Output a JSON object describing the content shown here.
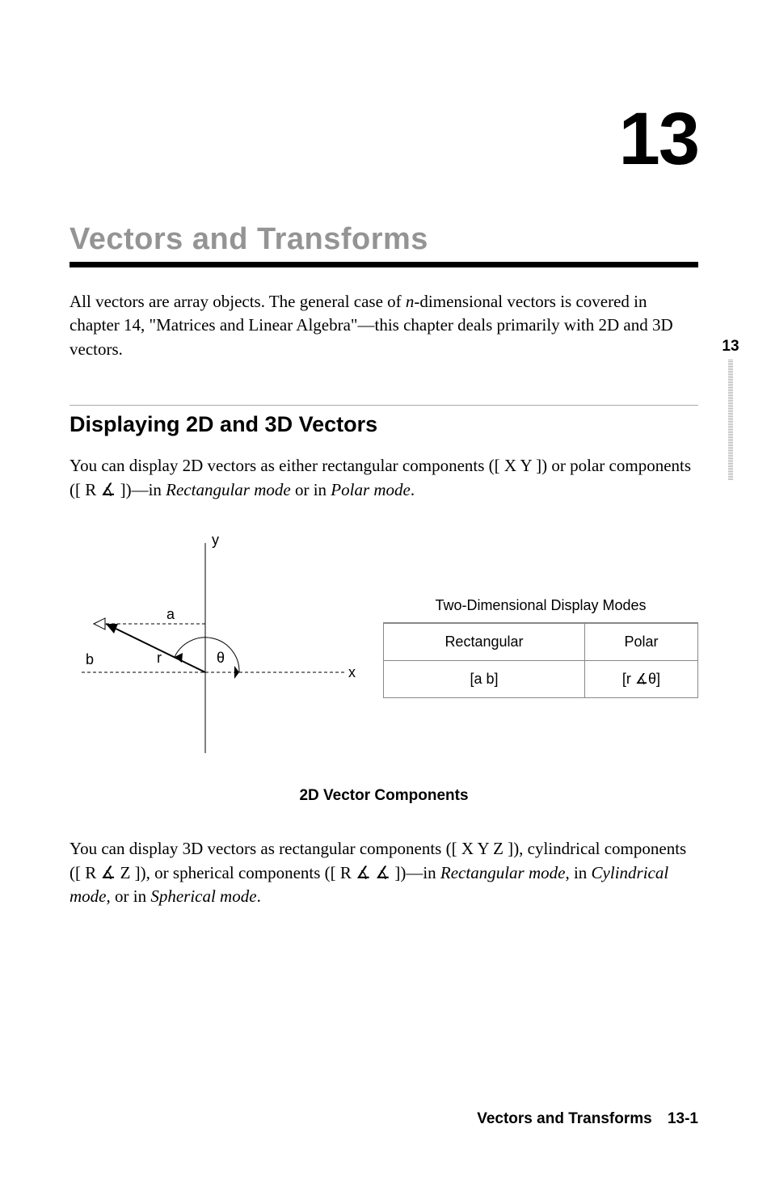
{
  "chapter": {
    "number": "13",
    "title": "Vectors and Transforms"
  },
  "intro": {
    "p1a": "All vectors are array objects. The general case of ",
    "p1b": "n",
    "p1c": "-dimensional vectors is covered in chapter 14, \"Matrices and Linear Algebra\"—this chapter deals primarily with 2D and 3D vectors."
  },
  "side_tab": "13",
  "section1": {
    "title": "Displaying 2D and 3D Vectors",
    "p1a": "You can display 2D vectors as either rectangular components (",
    "p1b": "[ X Y ]",
    "p1c": ") or polar components (",
    "p1d": "[ R ∡ ]",
    "p1e": ")—in ",
    "p1f": "Rectangular mode",
    "p1g": " or in ",
    "p1h": "Polar mode",
    "p1i": "."
  },
  "diagram": {
    "y": "y",
    "x": "x",
    "a": "a",
    "b": "b",
    "r": "r",
    "theta": "θ"
  },
  "table2d": {
    "caption": "Two-Dimensional Display Modes",
    "col1": "Rectangular",
    "col2": "Polar",
    "cell1": "[a b]",
    "cell2": "[r  ∡θ]"
  },
  "figure_caption": "2D Vector Components",
  "para3d": {
    "a": "You can display 3D vectors as rectangular components (",
    "b": "[ X Y Z ]",
    "c": "), cylindrical components (",
    "d": "[ R ∡ Z ]",
    "e": "), or spherical components (",
    "f": "[ R ∡ ∡ ]",
    "g": ")—in ",
    "h": "Rectangular mode",
    "i": ", in ",
    "j": "Cylindrical mode",
    "k": ", or in ",
    "l": "Spherical mode",
    "m": "."
  },
  "footer": {
    "title": "Vectors and Transforms",
    "page": "13-1"
  }
}
